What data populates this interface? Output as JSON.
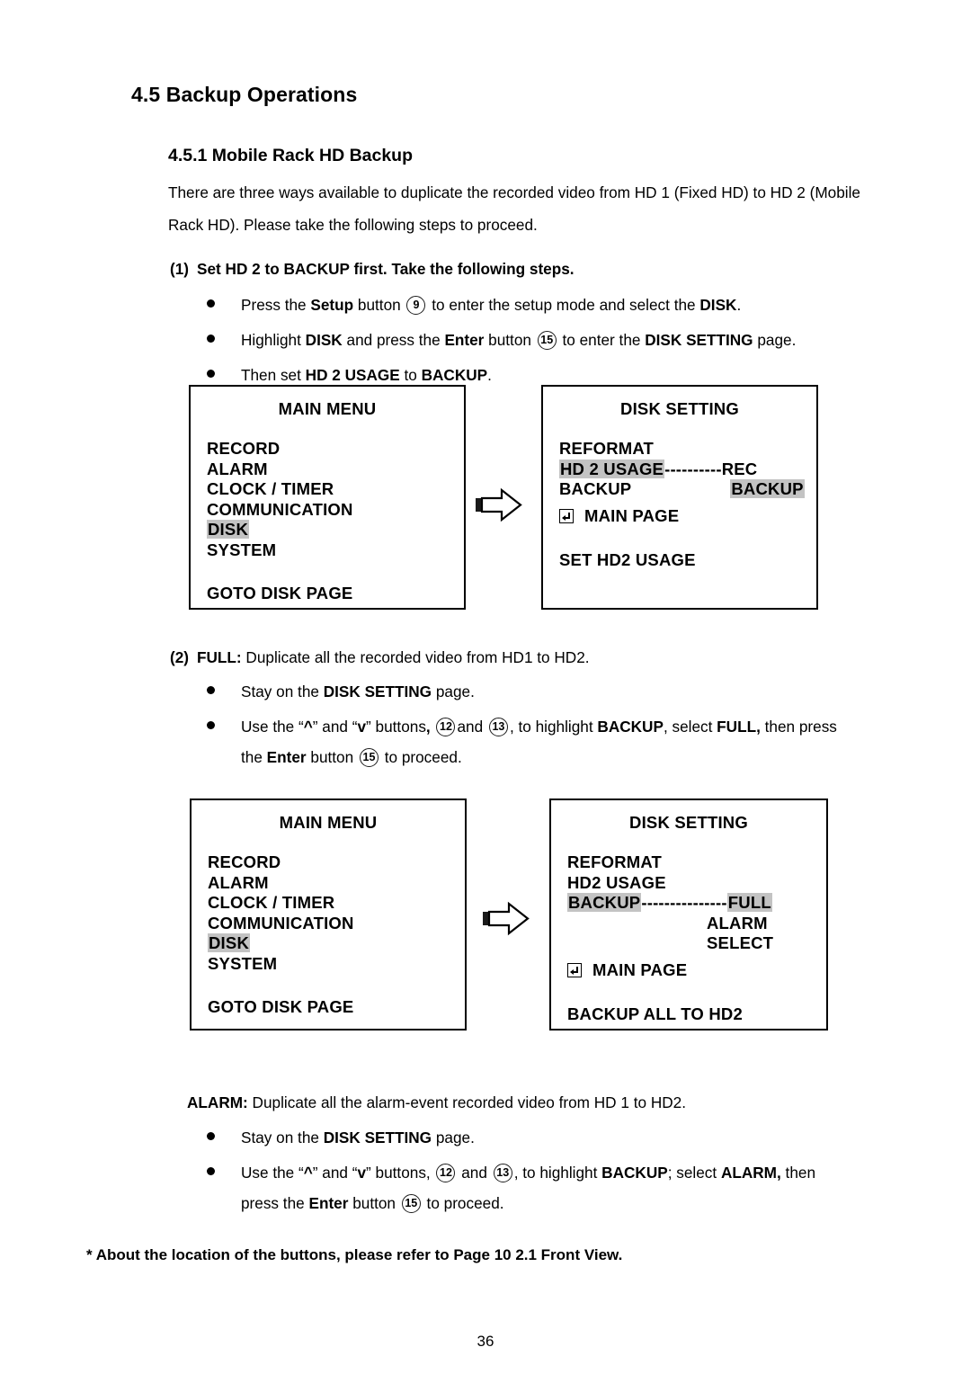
{
  "document": {
    "section_heading": "4.5 Backup Operations",
    "sub_heading": "4.5.1 Mobile Rack HD Backup",
    "intro_paragraph": "There are three ways available to duplicate the recorded video from HD 1 (Fixed HD) to HD 2 (Mobile Rack HD). Please take the following steps to proceed.",
    "footnote": "* About the location of the buttons, please refer to Page 10 2.1 Front View.",
    "page_number": "36"
  },
  "step1": {
    "number": "(1)",
    "title": "Set HD 2 to BACKUP first. Take the following steps.",
    "bullets": [
      {
        "parts": [
          {
            "t": "Press the ",
            "b": false
          },
          {
            "t": "Setup",
            "b": true
          },
          {
            "t": " button ",
            "b": false
          },
          {
            "t": "9",
            "circle": true
          },
          {
            "t": " to enter the setup mode and select the ",
            "b": false
          },
          {
            "t": "DISK",
            "b": true
          },
          {
            "t": ".",
            "b": false
          }
        ]
      },
      {
        "parts": [
          {
            "t": "Highlight ",
            "b": false
          },
          {
            "t": "DISK",
            "b": true
          },
          {
            "t": " and press the ",
            "b": false
          },
          {
            "t": "Enter",
            "b": true
          },
          {
            "t": " button ",
            "b": false
          },
          {
            "t": "15",
            "circle": true
          },
          {
            "t": " to enter the ",
            "b": false
          },
          {
            "t": "DISK SETTING",
            "b": true
          },
          {
            "t": " page.",
            "b": false
          }
        ]
      },
      {
        "parts": [
          {
            "t": "Then set ",
            "b": false
          },
          {
            "t": "HD 2 USAGE",
            "b": true
          },
          {
            "t": " to ",
            "b": false
          },
          {
            "t": "BACKUP",
            "b": true
          },
          {
            "t": ".",
            "b": false
          }
        ]
      }
    ]
  },
  "step2": {
    "number": "(2)",
    "label": "FULL:",
    "title_rest": " Duplicate all the recorded video from HD1 to HD2.",
    "bullets": [
      {
        "parts": [
          {
            "t": "Stay on the ",
            "b": false
          },
          {
            "t": "DISK SETTING",
            "b": true
          },
          {
            "t": " page.",
            "b": false
          }
        ]
      },
      {
        "parts": [
          {
            "t": "Use the “",
            "b": false
          },
          {
            "t": "^",
            "b": true
          },
          {
            "t": "” and “",
            "b": false
          },
          {
            "t": "v",
            "b": true
          },
          {
            "t": "” buttons",
            "b": false
          },
          {
            "t": ", ",
            "b": true
          },
          {
            "t": "12",
            "circle": true
          },
          {
            "t": "and ",
            "b": false
          },
          {
            "t": "13",
            "circle": true
          },
          {
            "t": ", to highlight ",
            "b": false
          },
          {
            "t": "BACKUP",
            "b": true
          },
          {
            "t": ", select ",
            "b": false
          },
          {
            "t": "FULL,",
            "b": true
          },
          {
            "t": " then press",
            "b": false
          }
        ],
        "cont": [
          {
            "t": "the ",
            "b": false
          },
          {
            "t": "Enter",
            "b": true
          },
          {
            "t": " button ",
            "b": false
          },
          {
            "t": "15",
            "circle": true
          },
          {
            "t": " to proceed.",
            "b": false
          }
        ]
      }
    ]
  },
  "step3": {
    "label": "ALARM:",
    "title_rest": " Duplicate all the alarm-event recorded video from HD 1 to HD2.",
    "bullets": [
      {
        "parts": [
          {
            "t": "Stay on the ",
            "b": false
          },
          {
            "t": "DISK SETTING",
            "b": true
          },
          {
            "t": " page.",
            "b": false
          }
        ]
      },
      {
        "parts": [
          {
            "t": "Use the “",
            "b": false
          },
          {
            "t": "^",
            "b": true
          },
          {
            "t": "” and “",
            "b": false
          },
          {
            "t": "v",
            "b": true
          },
          {
            "t": "” buttons, ",
            "b": false
          },
          {
            "t": "12",
            "circle": true
          },
          {
            "t": " and ",
            "b": false
          },
          {
            "t": "13",
            "circle": true
          },
          {
            "t": ", to highlight ",
            "b": false
          },
          {
            "t": "BACKUP",
            "b": true
          },
          {
            "t": "; select ",
            "b": false
          },
          {
            "t": "ALARM,",
            "b": true
          },
          {
            "t": " then",
            "b": false
          }
        ],
        "cont": [
          {
            "t": "press the ",
            "b": false
          },
          {
            "t": "Enter",
            "b": true
          },
          {
            "t": " button ",
            "b": false
          },
          {
            "t": "15",
            "circle": true
          },
          {
            "t": " to proceed.",
            "b": false
          }
        ]
      }
    ]
  },
  "figure1": {
    "main_menu": {
      "title": "MAIN MENU",
      "items": [
        {
          "label": "RECORD",
          "highlight": false
        },
        {
          "label": "ALARM",
          "highlight": false
        },
        {
          "label": "CLOCK / TIMER",
          "highlight": false
        },
        {
          "label": "COMMUNICATION",
          "highlight": false
        },
        {
          "label": "DISK",
          "highlight": true
        },
        {
          "label": "SYSTEM",
          "highlight": false
        }
      ],
      "hint": "GOTO DISK PAGE"
    },
    "disk_setting": {
      "title": "DISK SETTING",
      "rows": [
        {
          "label": "REFORMAT",
          "label_hl": false,
          "dots": "",
          "value": "",
          "value_hl": false
        },
        {
          "label": "HD 2 USAGE",
          "label_hl": true,
          "dots": "----------",
          "value": "REC",
          "value_hl": false
        },
        {
          "label": "BACKUP",
          "label_hl": false,
          "dots": "",
          "value": "BACKUP",
          "value_hl": true
        }
      ],
      "extra_values": [],
      "main_page": "MAIN PAGE",
      "hint": "SET HD2 USAGE"
    }
  },
  "figure2": {
    "main_menu": {
      "title": "MAIN MENU",
      "items": [
        {
          "label": "RECORD",
          "highlight": false
        },
        {
          "label": "ALARM",
          "highlight": false
        },
        {
          "label": "CLOCK / TIMER",
          "highlight": false
        },
        {
          "label": "COMMUNICATION",
          "highlight": false
        },
        {
          "label": "DISK",
          "highlight": true
        },
        {
          "label": "SYSTEM",
          "highlight": false
        }
      ],
      "hint": "GOTO DISK PAGE"
    },
    "disk_setting": {
      "title": "DISK SETTING",
      "rows": [
        {
          "label": "REFORMAT",
          "label_hl": false,
          "dots": "",
          "value": "",
          "value_hl": false
        },
        {
          "label": "HD2 USAGE",
          "label_hl": false,
          "dots": "",
          "value": "",
          "value_hl": false
        },
        {
          "label": "BACKUP",
          "label_hl": true,
          "dots": "---------------",
          "value": "FULL",
          "value_hl": true
        }
      ],
      "extra_values": [
        "ALARM",
        "SELECT"
      ],
      "main_page": "MAIN PAGE",
      "hint": "BACKUP ALL TO HD2"
    }
  },
  "colors": {
    "highlight": "#c3c3c3",
    "text": "#000000",
    "background": "#ffffff"
  },
  "icons": {
    "enter_return": "enter-return-icon",
    "flow_arrow": "right-block-arrow-icon",
    "bullet": "bullet-dot-icon"
  }
}
